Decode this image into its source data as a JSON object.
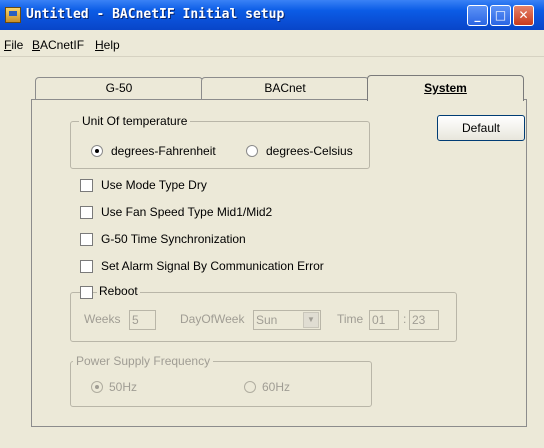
{
  "window": {
    "title": "Untitled - BACnetIF Initial setup",
    "minimize_glyph": "_",
    "maximize_glyph": "□",
    "close_glyph": "✕"
  },
  "menu": {
    "file_u": "F",
    "file_rest": "ile",
    "bacnet_u": "B",
    "bacnet_rest": "ACnetIF",
    "help_u": "H",
    "help_rest": "elp"
  },
  "tabs": {
    "g50": "G-50",
    "bacnet": "BACnet",
    "system": "System"
  },
  "system": {
    "unit_group_label": "Unit Of temperature",
    "fahrenheit_label": "degrees-Fahrenheit",
    "celsius_label": "degrees-Celsius",
    "default_button": "Default",
    "use_mode_type_dry": "Use Mode Type Dry",
    "use_fan_speed": "Use Fan Speed Type Mid1/Mid2",
    "g50_time_sync": "G-50 Time Synchronization",
    "set_alarm_signal": "Set Alarm Signal By Communication Error",
    "reboot_label": "Reboot",
    "weeks_label": "Weeks",
    "weeks_value": "5",
    "dayofweek_label": "DayOfWeek",
    "dayofweek_value": "Sun",
    "time_label": "Time",
    "time_hour": "01",
    "time_sep": ":",
    "time_minute": "23",
    "power_group_label": "Power Supply Frequency",
    "hz50_label": "50Hz",
    "hz60_label": "60Hz"
  },
  "colors": {
    "titlebar_blue": "#0a4fd6",
    "window_face": "#ece9d8",
    "disabled_text": "#a09d94"
  }
}
